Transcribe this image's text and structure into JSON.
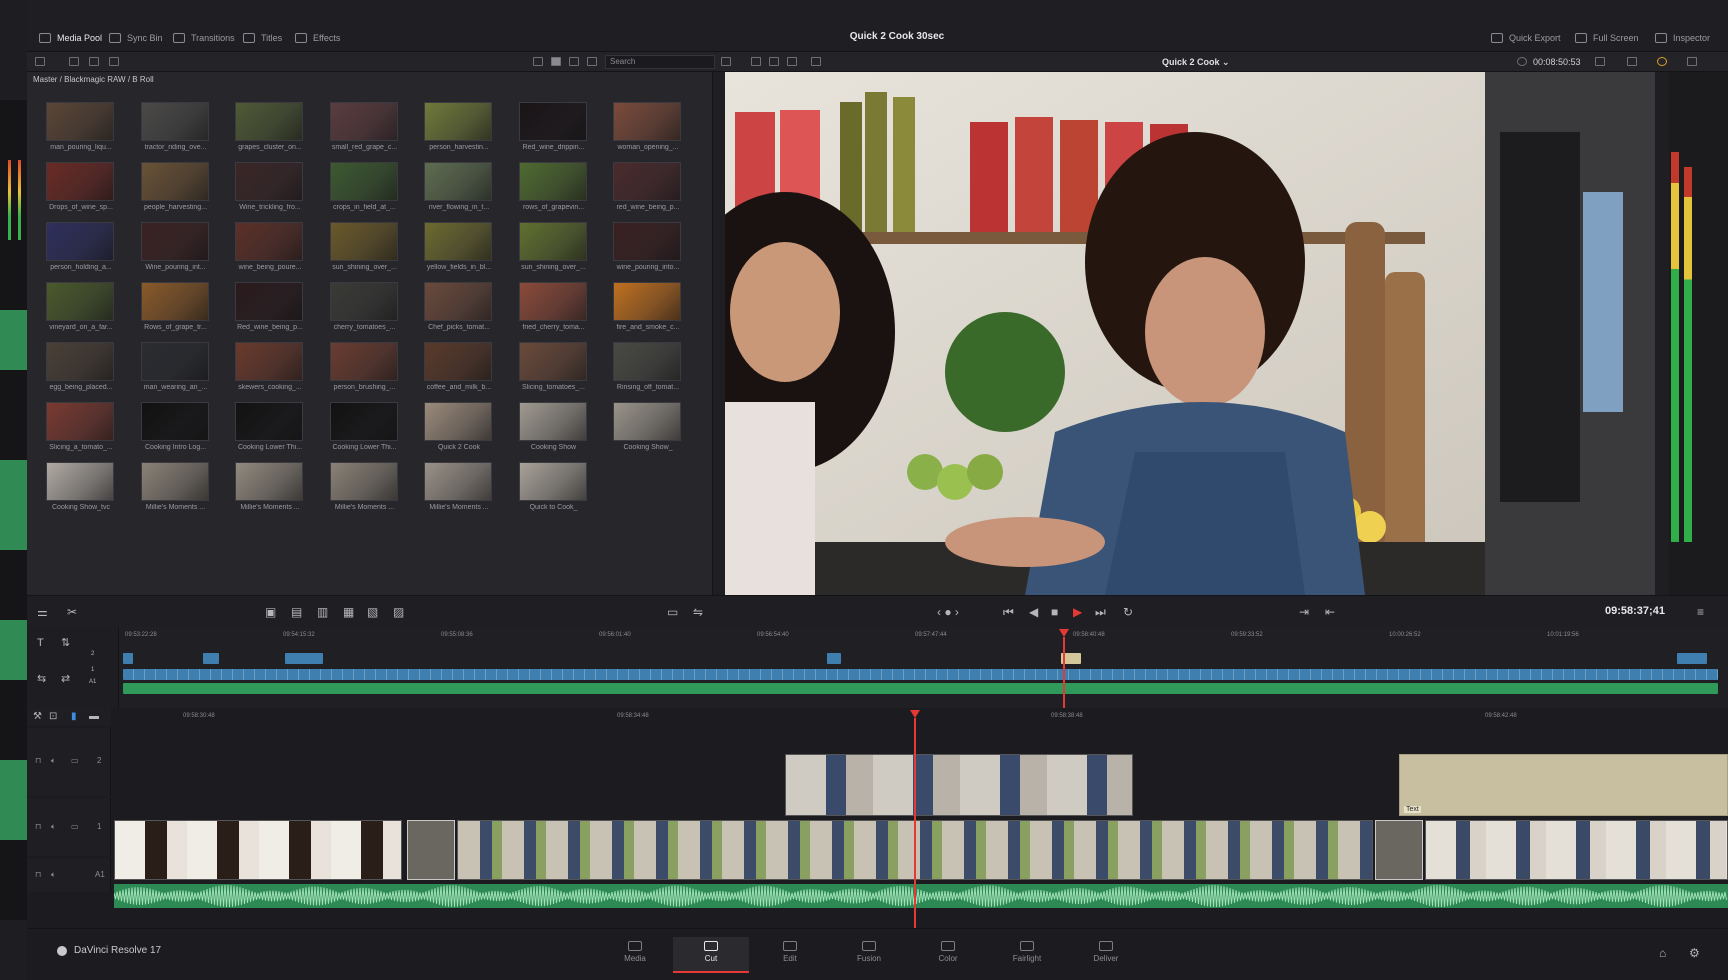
{
  "app": {
    "title": "Quick 2 Cook 30sec",
    "brand": "DaVinci Resolve 17"
  },
  "topbar": {
    "left": [
      {
        "name": "media-pool",
        "label": "Media Pool",
        "icon": "film-icon"
      },
      {
        "name": "sync-bin",
        "label": "Sync Bin",
        "icon": "sync-icon"
      },
      {
        "name": "transitions",
        "label": "Transitions",
        "icon": "transition-icon"
      },
      {
        "name": "titles",
        "label": "Titles",
        "icon": "text-icon"
      },
      {
        "name": "effects",
        "label": "Effects",
        "icon": "wand-icon"
      }
    ],
    "right": [
      {
        "name": "quick-export",
        "label": "Quick Export",
        "icon": "export-icon"
      },
      {
        "name": "full-screen",
        "label": "Full Screen",
        "icon": "fullscreen-icon"
      },
      {
        "name": "inspector",
        "label": "Inspector",
        "icon": "inspector-icon"
      }
    ]
  },
  "pool": {
    "search_placeholder": "Search",
    "breadcrumb": "Master / Blackmagic RAW / B Roll",
    "clips": [
      {
        "label": "man_pouring_liqu...",
        "color": "#5a4636"
      },
      {
        "label": "tractor_riding_ove...",
        "color": "#4b4a48"
      },
      {
        "label": "grapes_cluster_on...",
        "color": "#4f5a35"
      },
      {
        "label": "small_red_grape_c...",
        "color": "#5b3c3e"
      },
      {
        "label": "person_harvestin...",
        "color": "#6f7a3a"
      },
      {
        "label": "Red_wine_drippin...",
        "color": "#1a1416"
      },
      {
        "label": "woman_opening_...",
        "color": "#7a4b3b"
      },
      {
        "label": "Drops_of_wine_sp...",
        "color": "#6b2a24"
      },
      {
        "label": "people_harvesting...",
        "color": "#6a5236"
      },
      {
        "label": "Wine_trickling_fro...",
        "color": "#3a2626"
      },
      {
        "label": "crops_in_field_at_...",
        "color": "#3d5a30"
      },
      {
        "label": "river_flowing_in_t...",
        "color": "#5e6d50"
      },
      {
        "label": "rows_of_grapevin...",
        "color": "#4f6a30"
      },
      {
        "label": "red_wine_being_p...",
        "color": "#4a2a2c"
      },
      {
        "label": "person_holding_a...",
        "color": "#2e2f5c"
      },
      {
        "label": "Wine_pouring_int...",
        "color": "#3c2222"
      },
      {
        "label": "wine_being_poure...",
        "color": "#5c3028"
      },
      {
        "label": "sun_shining_over_...",
        "color": "#6a5a2a"
      },
      {
        "label": "yellow_fields_in_bl...",
        "color": "#6d6a30"
      },
      {
        "label": "sun_shining_over_...",
        "color": "#607030"
      },
      {
        "label": "wine_pouring_into...",
        "color": "#3a2020"
      },
      {
        "label": "vineyard_on_a_far...",
        "color": "#4a5a2c"
      },
      {
        "label": "Rows_of_grape_tr...",
        "color": "#8a5a2a"
      },
      {
        "label": "Red_wine_being_p...",
        "color": "#2a1a1c"
      },
      {
        "label": "cherry_tomatoes_...",
        "color": "#3a3a36"
      },
      {
        "label": "Chef_picks_tomat...",
        "color": "#6a4a3c"
      },
      {
        "label": "fried_cherry_toma...",
        "color": "#8a4a3a"
      },
      {
        "label": "fire_and_smoke_c...",
        "color": "#c07020"
      },
      {
        "label": "egg_being_placed...",
        "color": "#4a4036"
      },
      {
        "label": "man_wearing_an_...",
        "color": "#2a2c30"
      },
      {
        "label": "skewers_cooking_...",
        "color": "#6a3a2c"
      },
      {
        "label": "person_brushing_...",
        "color": "#6a3c30"
      },
      {
        "label": "coffee_and_milk_b...",
        "color": "#5a3a2a"
      },
      {
        "label": "Slicing_tomatoes_...",
        "color": "#6a4a3a"
      },
      {
        "label": "Rinsing_off_tomat...",
        "color": "#4a4a44"
      },
      {
        "label": "Slicing_a_tomato_...",
        "color": "#7a3a30"
      },
      {
        "label": "Cooking Intro Log...",
        "color": "#111111"
      },
      {
        "label": "Cooking Lower Thi...",
        "color": "#121212"
      },
      {
        "label": "Cooking Lower Thi...",
        "color": "#121212"
      },
      {
        "label": "Quick 2 Cook",
        "color": "#9a8a7a"
      },
      {
        "label": "Cooking Show",
        "color": "#a09a90"
      },
      {
        "label": "Cooking Show_",
        "color": "#9a948a"
      },
      {
        "label": "Cooking Show_tvc",
        "color": "#b0aaa2"
      },
      {
        "label": "Millie's Moments ...",
        "color": "#8a8276"
      },
      {
        "label": "Millie's Moments ...",
        "color": "#928a7e"
      },
      {
        "label": "Millie's Moments ...",
        "color": "#8a8276"
      },
      {
        "label": "Millie's Moments ...",
        "color": "#9a9288"
      },
      {
        "label": "Quick to Cook_",
        "color": "#a8a298"
      }
    ]
  },
  "viewer": {
    "clip_name": "Quick 2 Cook",
    "timecode_top": "00:08:50:53",
    "timecode_main": "09:58:37;41"
  },
  "upper_timeline": {
    "ticks": [
      "09:53:22:28",
      "09:54:15:32",
      "09:55:08:36",
      "09:56:01:40",
      "09:56:54:40",
      "09:57:47:44",
      "09:58:40:48",
      "09:59:33:52",
      "10:00:26:52",
      "10:01:19:56"
    ],
    "tracks": [
      "2",
      "1",
      "A1"
    ]
  },
  "lower_timeline": {
    "ticks": [
      "09:58:30:48",
      "09:58:34:48",
      "09:58:38:48",
      "09:58:42:48"
    ],
    "tracks": [
      "2",
      "1",
      "A1"
    ],
    "text_clip_label": "Text"
  },
  "pages": [
    {
      "name": "media",
      "label": "Media"
    },
    {
      "name": "cut",
      "label": "Cut",
      "active": true
    },
    {
      "name": "edit",
      "label": "Edit"
    },
    {
      "name": "fusion",
      "label": "Fusion"
    },
    {
      "name": "color",
      "label": "Color"
    },
    {
      "name": "fairlight",
      "label": "Fairlight"
    },
    {
      "name": "deliver",
      "label": "Deliver"
    }
  ]
}
